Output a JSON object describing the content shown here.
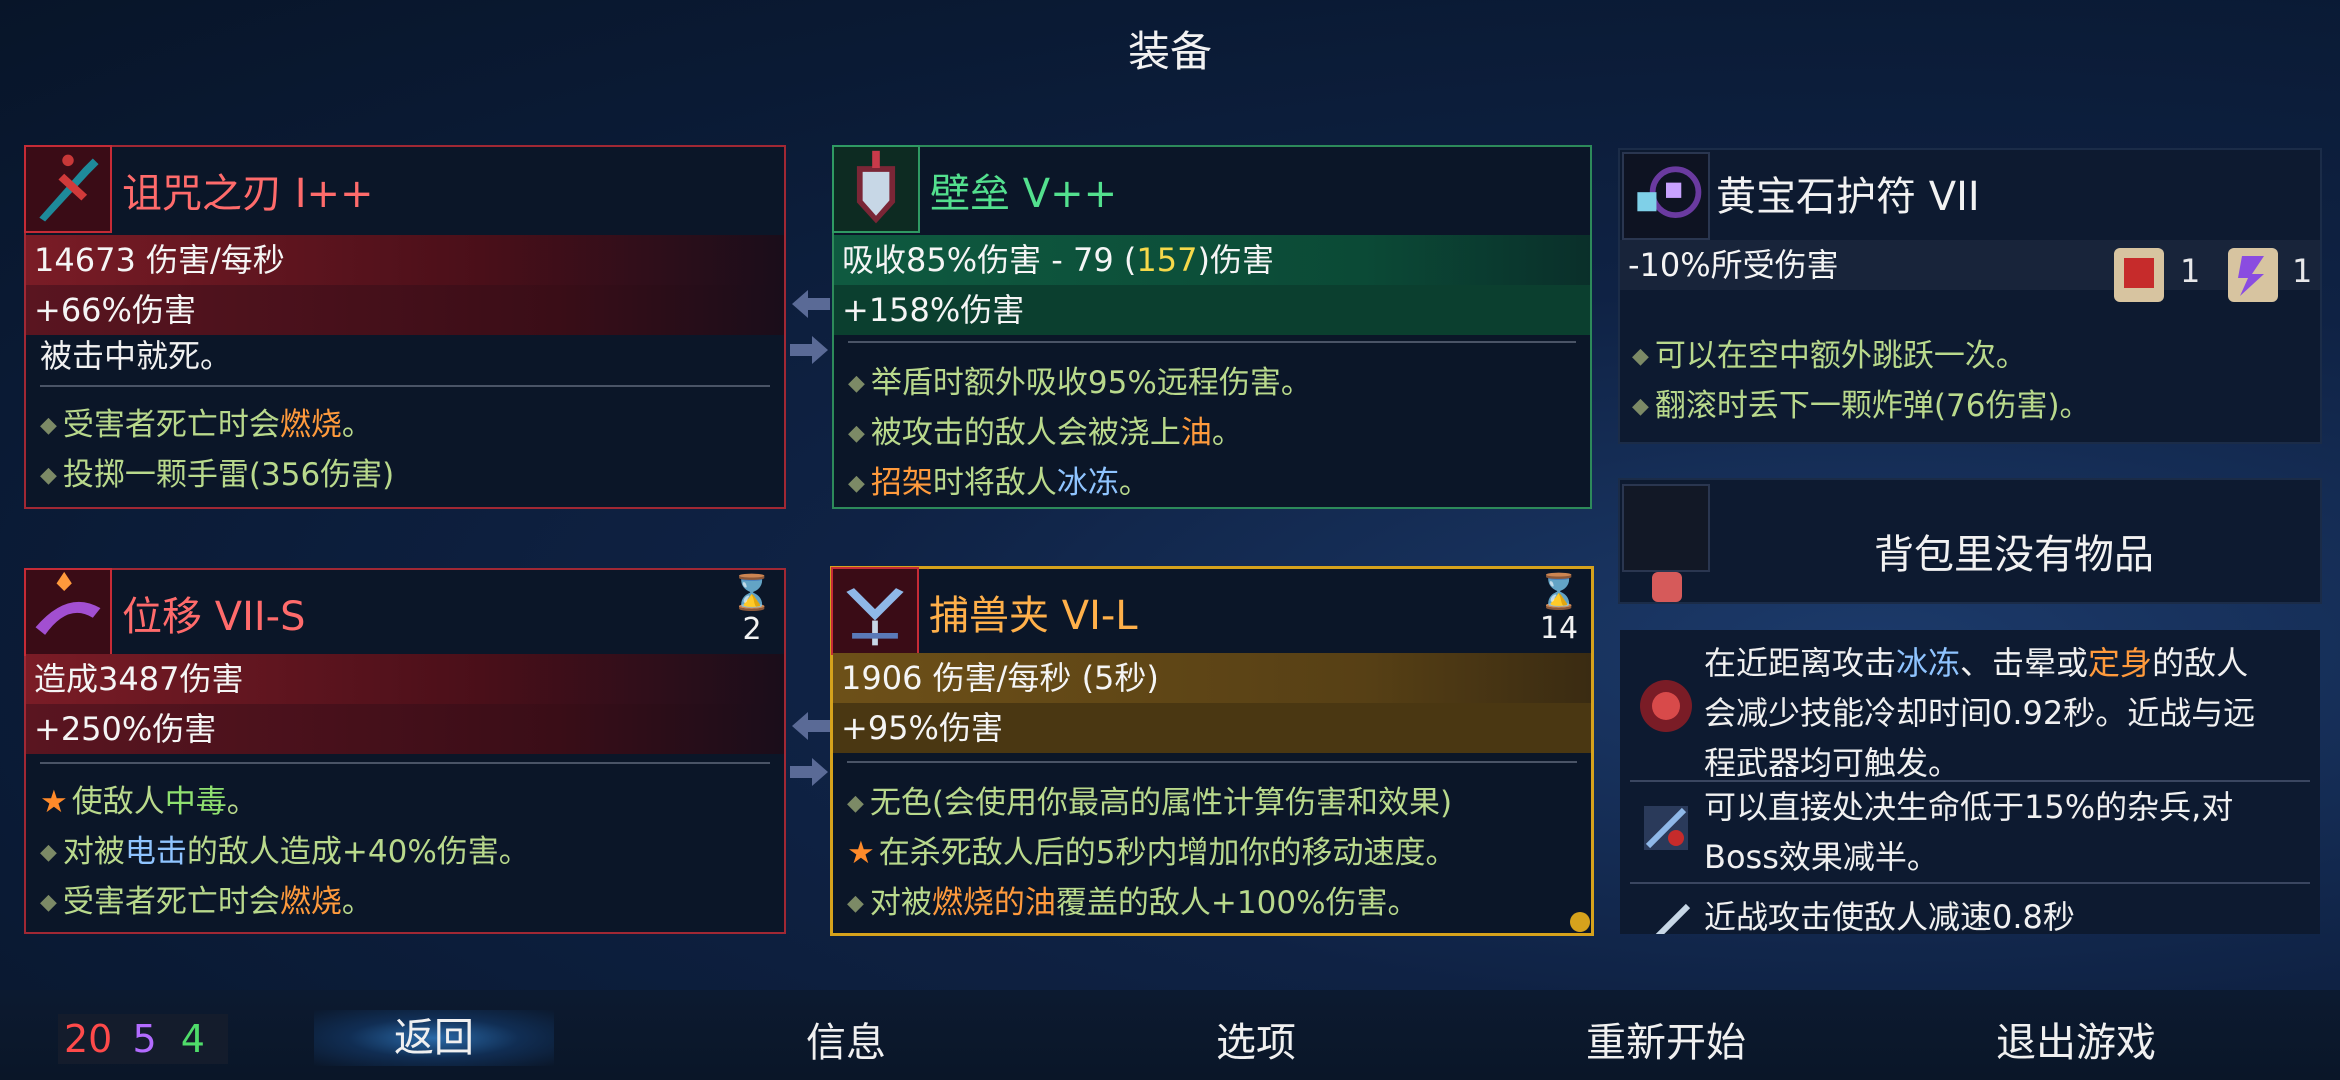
{
  "title": "装备",
  "weapon1": {
    "name": "诅咒之刃 I++",
    "stat1": "14673 伤害/每秒",
    "stat2": "+66%伤害",
    "desc": "被击中就死。",
    "bullets": [
      {
        "pre": "受害者死亡时会",
        "hl": "燃烧",
        "post": "。"
      },
      {
        "pre": "投掷一颗手雷(356伤害)",
        "hl": "",
        "post": ""
      }
    ]
  },
  "shield": {
    "name": "壁垒 V++",
    "stat1_pre": "吸收85%伤害 - 79 (",
    "stat1_hl": "157",
    "stat1_post": ")伤害",
    "stat2": "+158%伤害",
    "bullets": [
      {
        "pre": "举盾时额外吸收95%远程伤害。",
        "hl": "",
        "post": ""
      },
      {
        "pre": "被攻击的敌人会被浇上",
        "hl": "油",
        "post": "。"
      },
      {
        "hl1": "招架",
        "mid": "时将敌人",
        "hl2": "冰冻",
        "post": "。"
      }
    ]
  },
  "amulet": {
    "name": "黄宝石护符 VII",
    "stat1": "-10%所受伤害",
    "scroll1_count": "1",
    "scroll2_count": "1",
    "bullets": [
      "可以在空中额外跳跃一次。",
      "翻滚时丢下一颗炸弹(76伤害)。"
    ]
  },
  "skill1": {
    "name": "位移 VII-S",
    "cooldown": "2",
    "stat1": "造成3487伤害",
    "stat2": "+250%伤害",
    "bullets": [
      {
        "pre": "使敌人",
        "hl": "中毒",
        "post": "。"
      },
      {
        "pre": "对被",
        "hl": "电击",
        "post": "的敌人造成+40%伤害。"
      },
      {
        "pre": "受害者死亡时会",
        "hl": "燃烧",
        "post": "。"
      }
    ]
  },
  "skill2": {
    "name": "捕兽夹 VI-L",
    "cooldown": "14",
    "stat1": "1906 伤害/每秒 (5秒)",
    "stat2": "+95%伤害",
    "bullets": [
      {
        "pre": "无色(会使用你最高的属性计算伤害和效果)",
        "hl": "",
        "post": ""
      },
      {
        "pre": "在杀死敌人后的5秒内增加你的移动速度。",
        "hl": "",
        "post": ""
      },
      {
        "pre": "对被",
        "hl": "燃烧的油",
        "post": "覆盖的敌人+100%伤害。"
      }
    ]
  },
  "backpack": {
    "empty_text": "背包里没有物品"
  },
  "mutations": [
    {
      "l1_pre": "在近距离攻击",
      "l1_hl1": "冰冻",
      "l1_mid": "、击晕或",
      "l1_hl2": "定身",
      "l1_post": "的敌人",
      "l2": "会减少技能冷却时间0.92秒。近战与远",
      "l3": "程武器均可触发。"
    },
    {
      "l1": "可以直接处决生命低于15%的杂兵,对",
      "l2": "Boss效果减半。"
    },
    {
      "l1": "近战攻击使敌人减速0.8秒"
    }
  ],
  "scores": {
    "red": "20",
    "purple": "5",
    "green": "4",
    "colors": {
      "red": "#ff4a4a",
      "purple": "#b26bff",
      "green": "#4fdc6a"
    }
  },
  "menu": [
    "返回",
    "信息",
    "选项",
    "重新开始",
    "退出游戏"
  ]
}
